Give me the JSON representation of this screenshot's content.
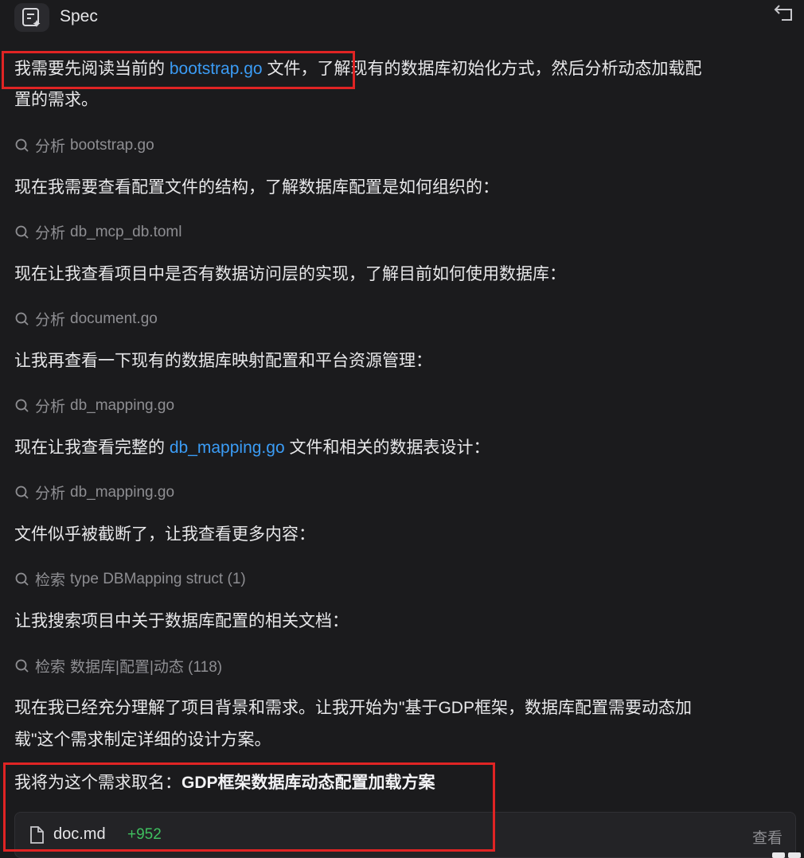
{
  "header": {
    "title": "Spec"
  },
  "messages": [
    {
      "pre": "我需要先阅读当前的 ",
      "link": "bootstrap.go",
      "post": " 文件，了解现有的数据库初始化方式，然后分析动态加载配"
    },
    {
      "text": "置的需求。"
    },
    {
      "text": "现在我需要查看配置文件的结构，了解数据库配置是如何组织的："
    },
    {
      "text": "现在让我查看项目中是否有数据访问层的实现，了解目前如何使用数据库："
    },
    {
      "text": "让我再查看一下现有的数据库映射配置和平台资源管理："
    },
    {
      "pre": "现在让我查看完整的 ",
      "link": "db_mapping.go",
      "post": " 文件和相关的数据表设计："
    },
    {
      "text": "文件似乎被截断了，让我查看更多内容："
    },
    {
      "text": "让我搜索项目中关于数据库配置的相关文档："
    },
    {
      "text": "现在我已经充分理解了项目背景和需求。让我开始为\"基于GDP框架，数据库配置需要动态加"
    },
    {
      "text": "载\"这个需求制定详细的设计方案。"
    },
    {
      "pre": "我将为这个需求取名：",
      "bold": "GDP框架数据库动态配置加载方案"
    }
  ],
  "tools": [
    {
      "action": "分析",
      "target": "bootstrap.go"
    },
    {
      "action": "分析",
      "target": "db_mcp_db.toml"
    },
    {
      "action": "分析",
      "target": "document.go"
    },
    {
      "action": "分析",
      "target": "db_mapping.go"
    },
    {
      "action": "分析",
      "target": "db_mapping.go"
    },
    {
      "action": "检索",
      "target": "type DBMapping struct  (1)"
    },
    {
      "action": "检索",
      "target": "数据库|配置|动态  (118)"
    }
  ],
  "file_card": {
    "name": "doc.md",
    "additions": "+952",
    "view_label": "查看"
  },
  "colors": {
    "background": "#1b1b1d",
    "link": "#3b9cf5",
    "highlight_box": "#e02424",
    "additions": "#3fbf5f"
  },
  "icons": [
    "spec-icon",
    "back-arrow-icon",
    "search-icon",
    "document-icon"
  ]
}
